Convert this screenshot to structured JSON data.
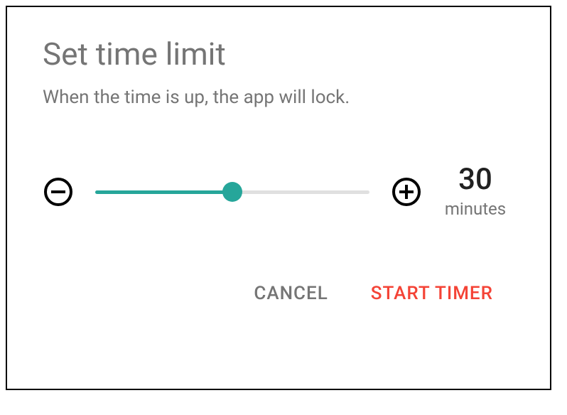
{
  "dialog": {
    "title": "Set time limit",
    "subtitle": "When the time is up, the app will lock."
  },
  "slider": {
    "value": 30,
    "unit": "minutes",
    "min": 0,
    "max": 60,
    "fill_percent": 50
  },
  "buttons": {
    "cancel": "CANCEL",
    "start": "START TIMER"
  },
  "colors": {
    "accent": "#26a69a",
    "danger": "#f44336",
    "text_secondary": "#757575"
  }
}
